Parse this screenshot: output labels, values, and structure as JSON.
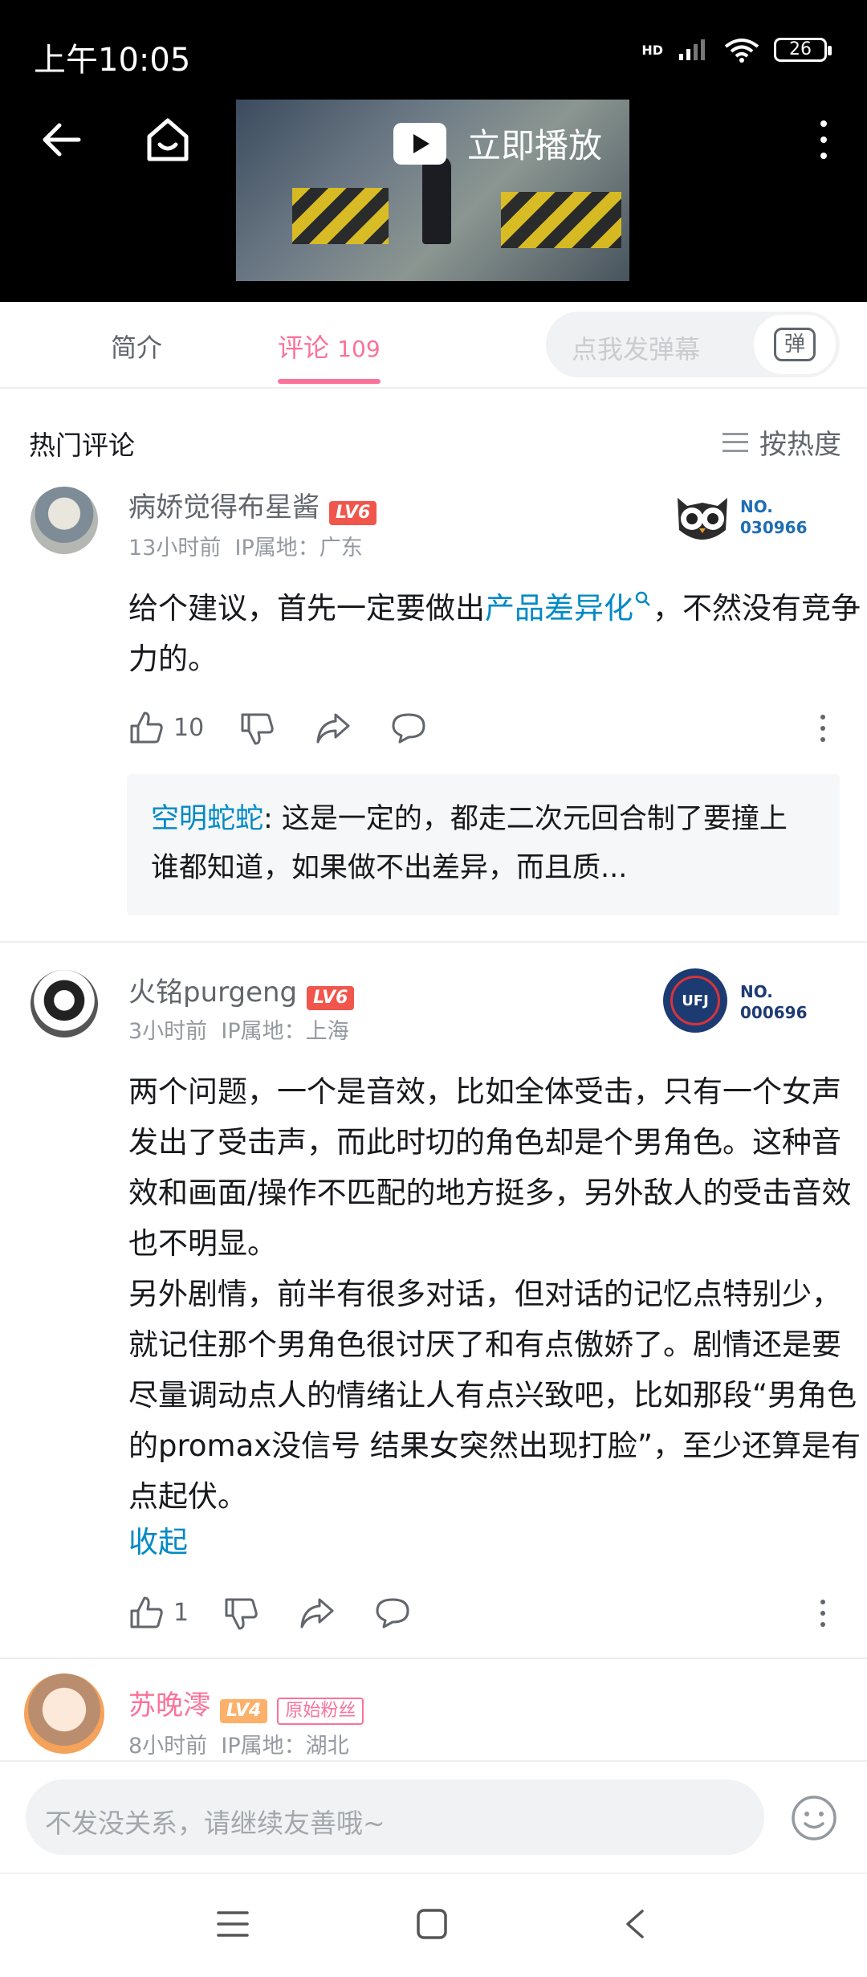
{
  "status": {
    "time": "上午10:05",
    "network": "HD",
    "battery": "26"
  },
  "video": {
    "play_label": "立即播放"
  },
  "tabs": {
    "intro": "简介",
    "comments_label": "评论",
    "comments_count": "109"
  },
  "danmu": {
    "placeholder": "点我发弹幕",
    "button_glyph": "弹"
  },
  "section": {
    "title": "热门评论",
    "sort_label": "按热度"
  },
  "comments": [
    {
      "username": "病娇觉得布星酱",
      "level": "LV6",
      "time": "13小时前",
      "ip": "IP属地：广东",
      "badge_no": "NO.",
      "badge_num": "030966",
      "content_before": "给个建议，首先一定要做出",
      "content_link": "产品差异化",
      "content_after": "，不然没有竞争力的。",
      "likes": "10",
      "reply": {
        "user": "空明蛇蛇",
        "text": ": 这是一定的，都走二次元回合制了要撞上谁都知道，如果做不出差异，而且质..."
      }
    },
    {
      "username": "火铭purgeng",
      "level": "LV6",
      "time": "3小时前",
      "ip": "IP属地：上海",
      "badge_no": "NO.",
      "badge_num": "000696",
      "badge_logo": "UFJ",
      "content": "两个问题，一个是音效，比如全体受击，只有一个女声发出了受击声，而此时切的角色却是个男角色。这种音效和画面/操作不匹配的地方挺多，另外敌人的受击音效也不明显。\n另外剧情，前半有很多对话，但对话的记忆点特别少，就记住那个男角色很讨厌了和有点傲娇了。剧情还是要尽量调动点人的情绪让人有点兴致吧，比如那段“男角色的promax没信号 结果女突然出现打脸”，至少还算是有点起伏。",
      "collapse_label": "收起",
      "likes": "1"
    },
    {
      "username": "苏晚澪",
      "level": "LV4",
      "fan_tag": "原始粉丝",
      "time": "8小时前",
      "ip": "IP属地：湖北"
    }
  ],
  "input": {
    "placeholder": "不发没关系，请继续友善哦~"
  },
  "colors": {
    "accent": "#fb7299",
    "link": "#008ac5",
    "lv6": "#f1564c",
    "lv4": "#fdb06a"
  }
}
